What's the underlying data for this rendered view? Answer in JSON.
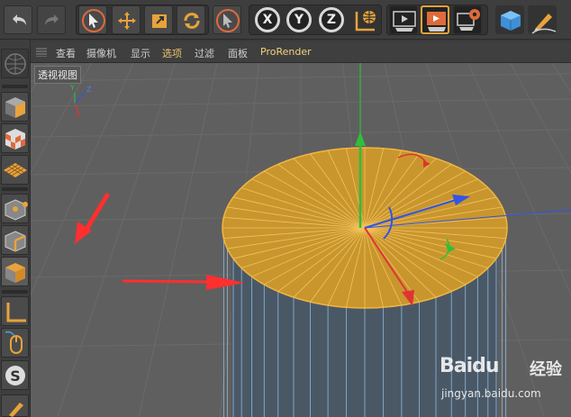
{
  "menubar": {
    "items": [
      "查看",
      "摄像机",
      "显示",
      "选项",
      "过滤",
      "面板",
      "ProRender"
    ],
    "active_index": 3
  },
  "viewport": {
    "label": "透视视图",
    "axis_labels": {
      "y": "Y",
      "z": "Z",
      "x": "X"
    }
  },
  "toolbar": {
    "axis_x": "X",
    "axis_y": "Y",
    "axis_z": "Z",
    "icons": [
      "undo-icon",
      "redo-icon",
      "select-arrow-icon",
      "move-icon",
      "scale-icon",
      "rotate-icon",
      "live-select-icon",
      "x-axis-icon",
      "y-axis-icon",
      "z-axis-icon",
      "world-coordinate-icon",
      "render-view-icon",
      "render-picture-viewer-icon",
      "render-settings-icon",
      "cube-icon",
      "pen-icon"
    ]
  },
  "sidebar": {
    "icons": [
      "make-editable-icon",
      "model-mode-icon",
      "texture-mode-icon",
      "workplane-icon",
      "points-mode-icon",
      "edges-mode-icon",
      "polygons-mode-icon",
      "axis-mode-icon",
      "tweak-mouse-icon",
      "snap-icon",
      "sculpt-icon"
    ]
  },
  "watermark": {
    "brand": "Baidu",
    "brand_cn": "经验",
    "url": "jingyan.baidu.com"
  },
  "colors": {
    "selection": "#e8a33b",
    "cap_fill": "#c9962e",
    "x_axis": "#e03434",
    "y_axis": "#2fbf3a",
    "z_axis": "#3355e0",
    "side_fill": "#4a5866",
    "viewport_bg": "#5f5f5f"
  }
}
